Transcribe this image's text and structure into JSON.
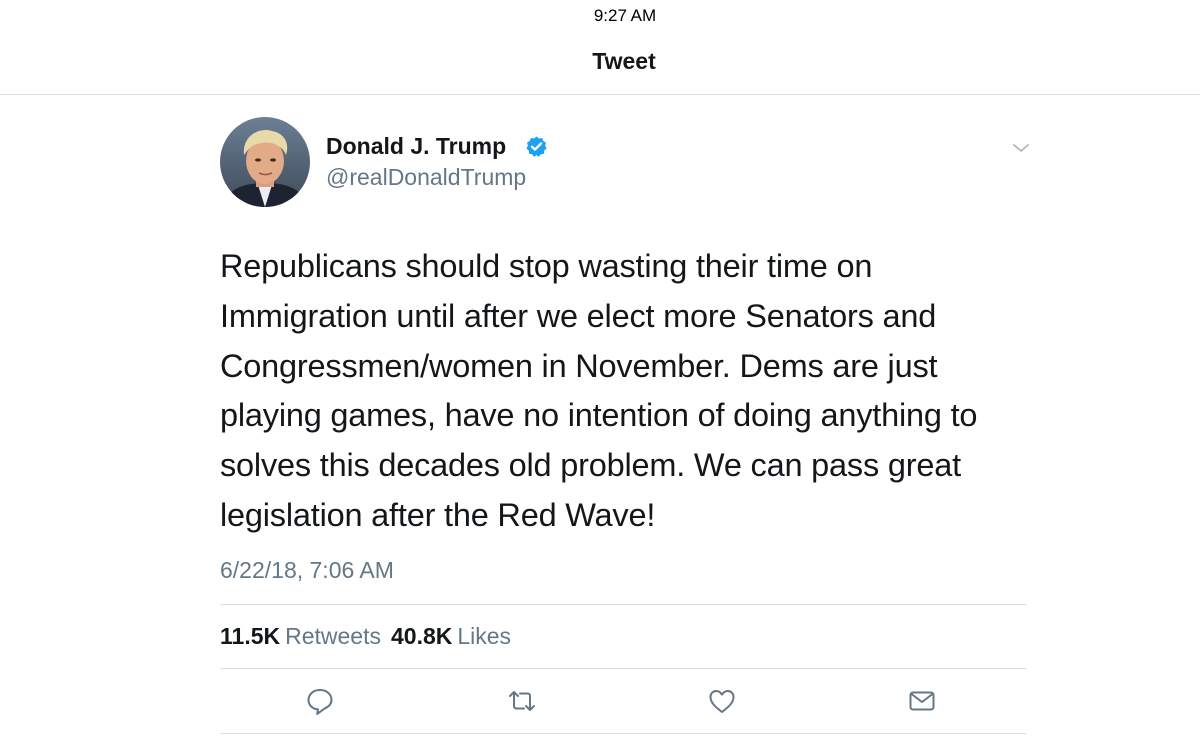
{
  "status_bar": {
    "time": "9:27 AM"
  },
  "nav": {
    "title": "Tweet"
  },
  "tweet": {
    "author": {
      "name": "Donald J. Trump",
      "handle": "@realDonaldTrump",
      "verified": true
    },
    "text": "Republicans should stop wasting their time on Immigration until after we elect more Senators and Congressmen/women in November. Dems are just playing games, have no intention of doing anything to solves this decades old problem. We can pass great legislation after the Red Wave!",
    "timestamp": "6/22/18, 7:06 AM",
    "stats": {
      "retweets_count": "11.5K",
      "retweets_label": "Retweets",
      "likes_count": "40.8K",
      "likes_label": "Likes"
    }
  },
  "actions": [
    {
      "icon": "reply-icon"
    },
    {
      "icon": "retweet-icon"
    },
    {
      "icon": "like-icon"
    },
    {
      "icon": "direct-message-icon"
    }
  ],
  "colors": {
    "text_primary": "#14171a",
    "text_secondary": "#657786",
    "verified_blue": "#1da1f2",
    "divider": "#d8dde1"
  }
}
